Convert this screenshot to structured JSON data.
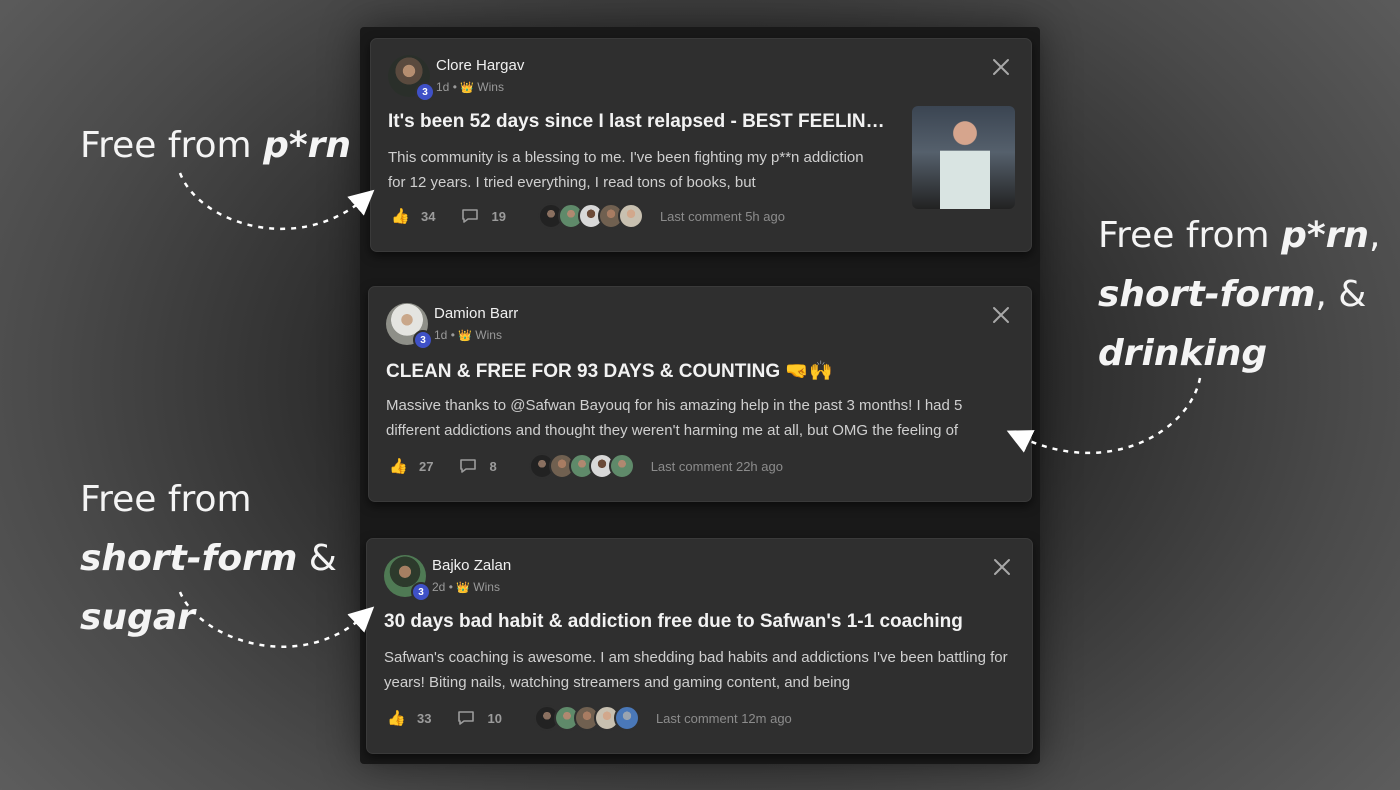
{
  "posts": [
    {
      "author": "Clore Hargav",
      "level": "3",
      "time": "1d",
      "category": "Wins",
      "title": "It's been 52 days since I last relapsed - BEST FEELING ...",
      "body": "This community is a blessing to me. I've been fighting my p**n addiction for 12 years. I tried everything, I read tons of books, but",
      "likes": "34",
      "comments": "19",
      "last_comment": "Last comment 5h ago"
    },
    {
      "author": "Damion Barr",
      "level": "3",
      "time": "1d",
      "category": "Wins",
      "title": "CLEAN & FREE FOR 93 DAYS & COUNTING 🤜🙌",
      "body": "Massive thanks to @Safwan Bayouq for his amazing help in the past 3 months! I had 5 different addictions and thought they weren't harming me at all, but OMG the feeling of",
      "likes": "27",
      "comments": "8",
      "last_comment": "Last comment 22h ago"
    },
    {
      "author": "Bajko Zalan",
      "level": "3",
      "time": "2d",
      "category": "Wins",
      "title": "30 days bad habit & addiction free due to Safwan's 1-1 coaching",
      "body": "Safwan's coaching is awesome. I am shedding bad habits and addictions I've been battling for years! Biting nails, watching streamers and gaming content, and being",
      "likes": "33",
      "comments": "10",
      "last_comment": "Last comment 12m ago"
    }
  ],
  "annotations": {
    "a1": {
      "prefix": "Free from ",
      "bold": "p*rn"
    },
    "a2": {
      "line1": "Free from",
      "bold1": "short-form",
      "mid": " &",
      "bold2": "sugar"
    },
    "a3": {
      "prefix": "Free from ",
      "bold1": "p*rn",
      "comma": ",",
      "bold2": "short-form",
      "mid": ", &",
      "bold3": "drinking"
    }
  },
  "colors": {
    "card_bg": "#2f2f2f",
    "badge": "#3f51c7",
    "accent": "#e0b030"
  },
  "icons": {
    "like": "thumbs-up-icon",
    "comment": "comment-icon",
    "close": "close-icon",
    "crown": "crown-icon"
  }
}
